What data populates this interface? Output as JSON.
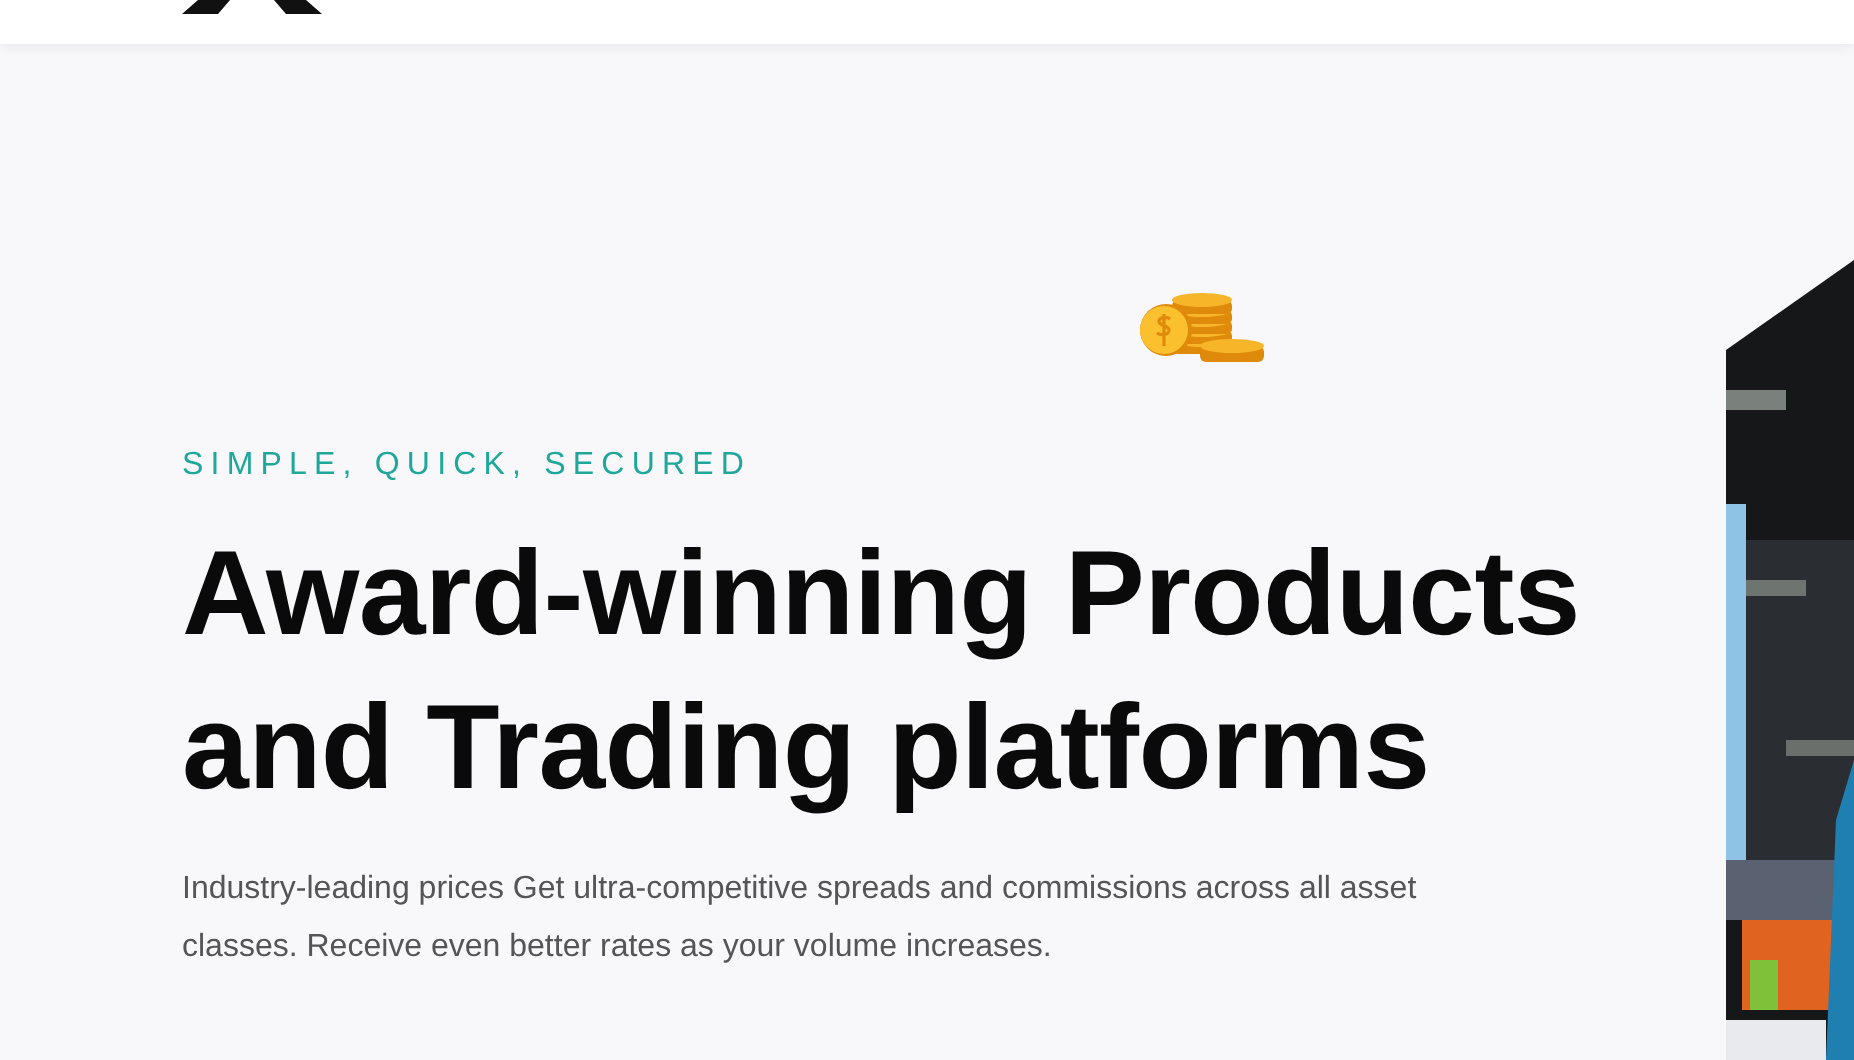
{
  "hero": {
    "tagline": "SIMPLE, QUICK, SECURED",
    "heading_lines": [
      "Award-winning Products",
      "and Trading platforms"
    ],
    "description": "Industry-leading prices Get ultra-competitive spreads and commissions across all asset classes. Receive even better rates as your volume increases."
  }
}
